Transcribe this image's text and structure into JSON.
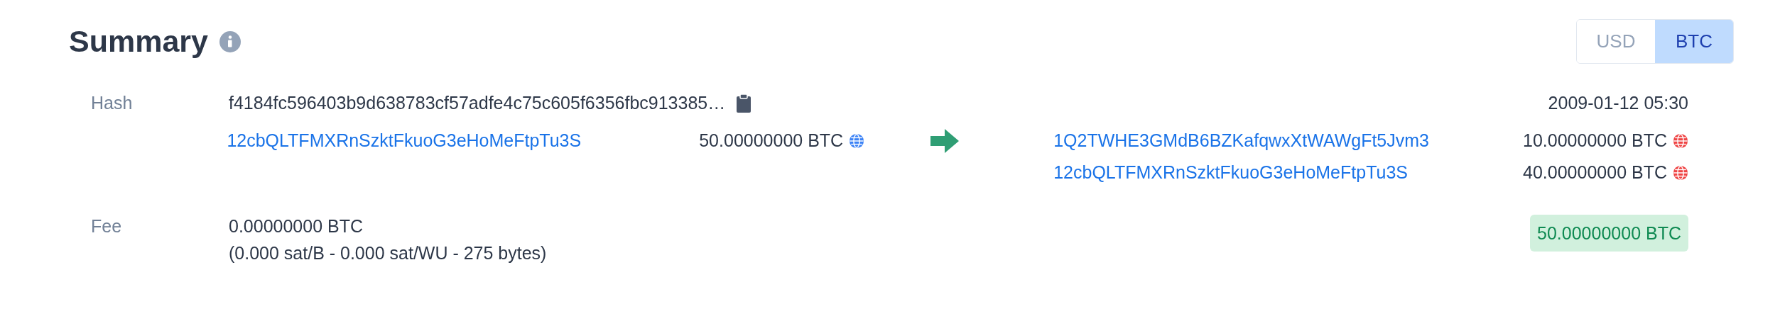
{
  "title": "Summary",
  "currency_toggle": [
    {
      "label": "USD",
      "selected": false
    },
    {
      "label": "BTC",
      "selected": true
    }
  ],
  "hash": {
    "label": "Hash",
    "value": "f4184fc596403b9d638783cf57adfe4c75c605f6356fbc913385…",
    "time": "2009-01-12 05:30"
  },
  "inputs": [
    {
      "address": "12cbQLTFMXRnSzktFkuoG3eHoMeFtpTu3S",
      "amount": "50.00000000 BTC",
      "color": "#3b82f6"
    }
  ],
  "outputs": [
    {
      "address": "1Q2TWHE3GMdB6BZKafqwxXtWAWgFt5Jvm3",
      "amount": "10.00000000 BTC",
      "color": "#ef4444"
    },
    {
      "address": "12cbQLTFMXRnSzktFkuoG3eHoMeFtpTu3S",
      "amount": "40.00000000 BTC",
      "color": "#ef4444"
    }
  ],
  "fee": {
    "label": "Fee",
    "value": "0.00000000 BTC",
    "detail": "(0.000 sat/B - 0.000 sat/WU - 275 bytes)",
    "total": "50.00000000 BTC"
  }
}
